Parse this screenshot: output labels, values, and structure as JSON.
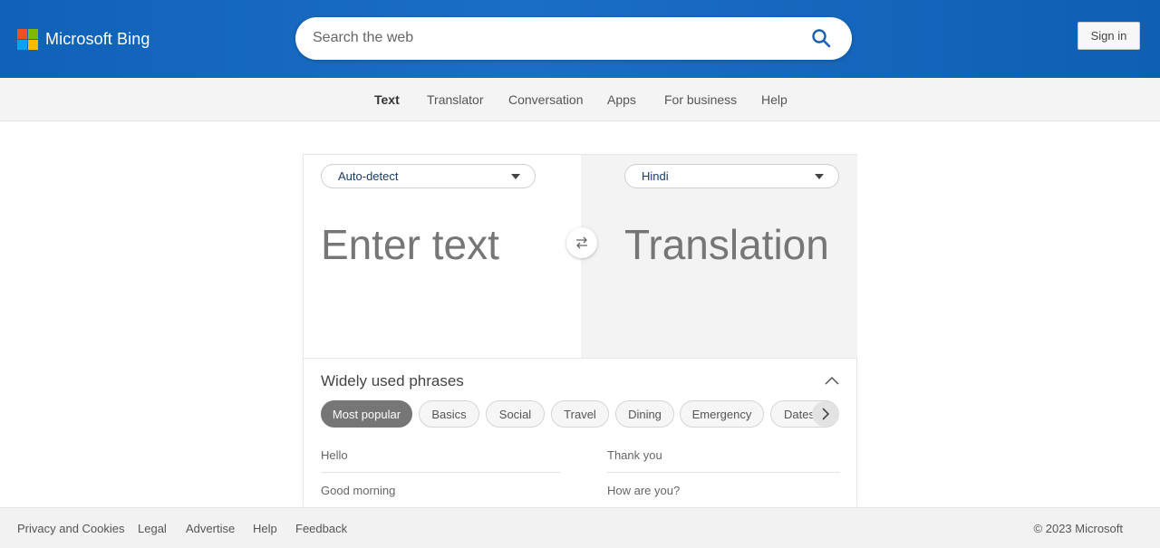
{
  "header": {
    "brand": "Microsoft Bing",
    "search_placeholder": "Search the web",
    "signin_label": "Sign in",
    "logo_colors": [
      "#f25022",
      "#7fba00",
      "#00a4ef",
      "#ffb900"
    ],
    "icons": {
      "search": "search-icon",
      "logo": "microsoft-logo-icon"
    }
  },
  "subnav": {
    "items": [
      {
        "label": "Text",
        "active": true
      },
      {
        "label": "Translator",
        "active": false
      },
      {
        "label": "Conversation",
        "active": false
      },
      {
        "label": "Apps",
        "active": false
      },
      {
        "label": "For business",
        "active": false
      },
      {
        "label": "Help",
        "active": false
      }
    ]
  },
  "translator": {
    "source_language": "Auto-detect",
    "target_language": "Hindi",
    "input_placeholder": "Enter text",
    "output_placeholder": "Translation",
    "icons": {
      "swap": "swap-icon",
      "dropdown": "chevron-down-icon"
    }
  },
  "phrases": {
    "title": "Widely used phrases",
    "chips": [
      {
        "label": "Most popular",
        "active": true
      },
      {
        "label": "Basics",
        "active": false
      },
      {
        "label": "Social",
        "active": false
      },
      {
        "label": "Travel",
        "active": false
      },
      {
        "label": "Dining",
        "active": false
      },
      {
        "label": "Emergency",
        "active": false
      },
      {
        "label": "Dates",
        "active": false
      }
    ],
    "left": [
      "Hello",
      "Good morning"
    ],
    "right": [
      "Thank you",
      "How are you?"
    ]
  },
  "footer": {
    "links": [
      "Privacy and Cookies",
      "Legal",
      "Advertise",
      "Help",
      "Feedback"
    ],
    "copyright": "© 2023 Microsoft"
  },
  "colors": {
    "header_blue": "#1062b8",
    "active_chip": "#767676",
    "language_text": "#1a3b66"
  }
}
